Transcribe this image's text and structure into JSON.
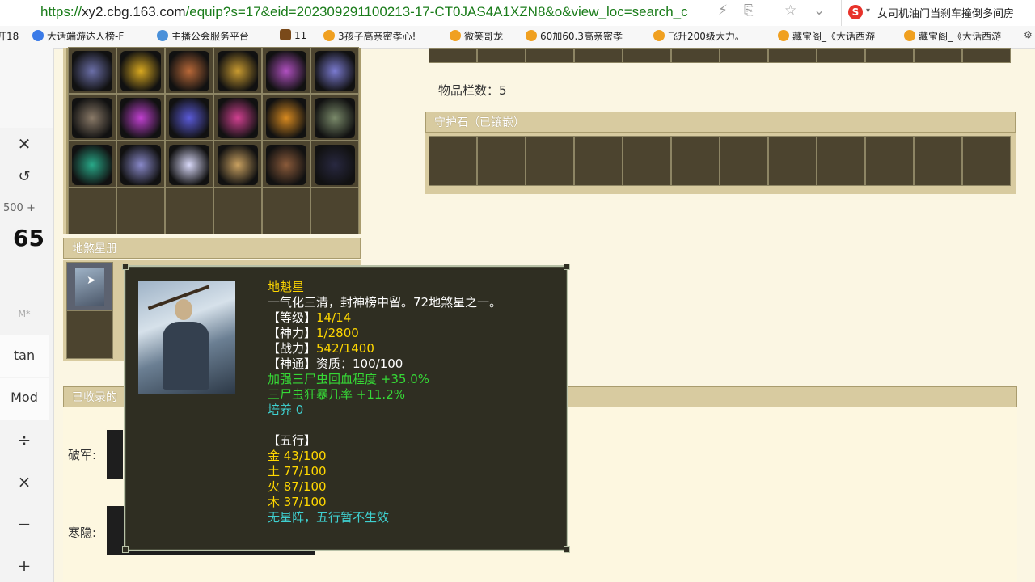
{
  "browser": {
    "url_prefix": "https://",
    "url_host": "xy2.cbg.163.com",
    "url_path": "/equip?s=17&eid=202309291100213-17-CT0JAS4A1XZN8&o&view_loc=search_c",
    "search_text": "女司机油门当刹车撞倒多间房"
  },
  "bookmarks": [
    {
      "label": "开18"
    },
    {
      "label": "大话端游达人榜-F"
    },
    {
      "label": "主播公会服务平台"
    },
    {
      "label": "11"
    },
    {
      "label": "3孩子高亲密孝心!"
    },
    {
      "label": "微笑哥龙"
    },
    {
      "label": "60加60.3高亲密孝"
    },
    {
      "label": "飞升200级大力。"
    },
    {
      "label": "藏宝阁_《大话西游"
    },
    {
      "label": "藏宝阁_《大话西游"
    }
  ],
  "calculator": {
    "expression": "500 +",
    "display": "65",
    "memory_label": "M*",
    "buttons": [
      "tan",
      "Mod",
      "÷",
      "×",
      "−",
      "+"
    ]
  },
  "inventory": {
    "count_label": "物品栏数：5"
  },
  "guard_stone": {
    "title": "守护石（已镶嵌）"
  },
  "star_book": {
    "title": "地煞星册"
  },
  "collected": {
    "title_fragment": "已收录的",
    "rows": [
      "破军:",
      "寒隐:"
    ]
  },
  "tooltip": {
    "name": "地魁星",
    "desc": "一气化三清，封神榜中留。72地煞星之一。",
    "level_label": "【等级】",
    "level_value": "14/14",
    "spirit_label": "【神力】",
    "spirit_value": "1/2800",
    "battle_label": "【战力】",
    "battle_value": "542/1400",
    "skill_label": "【神通】",
    "skill_value": "资质：100/100",
    "bonus1": "加强三尸虫回血程度 +35.0%",
    "bonus2": "三尸虫狂暴几率 +11.2%",
    "cultivate": "培养 0",
    "five_title": "【五行】",
    "metal": "金 43/100",
    "earth": "土 77/100",
    "fire": "火 87/100",
    "wood": "木 37/100",
    "note": "无星阵，五行暂不生效"
  }
}
